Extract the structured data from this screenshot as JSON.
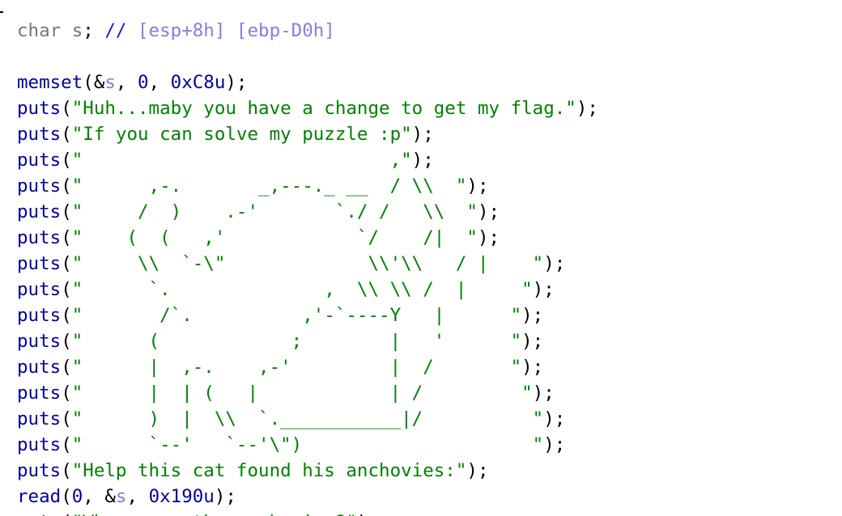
{
  "lines": [
    [
      {
        "t": "char",
        "c": "type"
      },
      {
        "t": " ",
        "c": "punct"
      },
      {
        "t": "s",
        "c": "var-gray"
      },
      {
        "t": "; ",
        "c": "punct"
      },
      {
        "t": "// ",
        "c": "comment"
      },
      {
        "t": "[esp+8h] [ebp-D0h]",
        "c": "addr"
      }
    ],
    [],
    [
      {
        "t": "memset",
        "c": "func"
      },
      {
        "t": "(&",
        "c": "punct"
      },
      {
        "t": "s",
        "c": "var"
      },
      {
        "t": ", ",
        "c": "punct"
      },
      {
        "t": "0",
        "c": "num"
      },
      {
        "t": ", ",
        "c": "punct"
      },
      {
        "t": "0xC8u",
        "c": "num"
      },
      {
        "t": ");",
        "c": "punct"
      }
    ],
    [
      {
        "t": "puts",
        "c": "func"
      },
      {
        "t": "(",
        "c": "punct"
      },
      {
        "t": "\"Huh...maby you have a change to get my flag.\"",
        "c": "str"
      },
      {
        "t": ");",
        "c": "punct"
      }
    ],
    [
      {
        "t": "puts",
        "c": "func"
      },
      {
        "t": "(",
        "c": "punct"
      },
      {
        "t": "\"If you can solve my puzzle :p\"",
        "c": "str"
      },
      {
        "t": ");",
        "c": "punct"
      }
    ],
    [
      {
        "t": "puts",
        "c": "func"
      },
      {
        "t": "(",
        "c": "punct"
      },
      {
        "t": "\"                            ,\"",
        "c": "str"
      },
      {
        "t": ");",
        "c": "punct"
      }
    ],
    [
      {
        "t": "puts",
        "c": "func"
      },
      {
        "t": "(",
        "c": "punct"
      },
      {
        "t": "\"      ,-.       _,---._ __  / \\\\  \"",
        "c": "str"
      },
      {
        "t": ");",
        "c": "punct"
      }
    ],
    [
      {
        "t": "puts",
        "c": "func"
      },
      {
        "t": "(",
        "c": "punct"
      },
      {
        "t": "\"     /  )    .-'       `./ /   \\\\  \"",
        "c": "str"
      },
      {
        "t": ");",
        "c": "punct"
      }
    ],
    [
      {
        "t": "puts",
        "c": "func"
      },
      {
        "t": "(",
        "c": "punct"
      },
      {
        "t": "\"    (  (   ,'            `/    /|  \"",
        "c": "str"
      },
      {
        "t": ");",
        "c": "punct"
      }
    ],
    [
      {
        "t": "puts",
        "c": "func"
      },
      {
        "t": "(",
        "c": "punct"
      },
      {
        "t": "\"     \\\\  `-\\\"             \\\\'\\\\   / |    \"",
        "c": "str"
      },
      {
        "t": ");",
        "c": "punct"
      }
    ],
    [
      {
        "t": "puts",
        "c": "func"
      },
      {
        "t": "(",
        "c": "punct"
      },
      {
        "t": "\"      `.              ,  \\\\ \\\\ /  |     \"",
        "c": "str"
      },
      {
        "t": ");",
        "c": "punct"
      }
    ],
    [
      {
        "t": "puts",
        "c": "func"
      },
      {
        "t": "(",
        "c": "punct"
      },
      {
        "t": "\"       /`.          ,'-`----Y   |      \"",
        "c": "str"
      },
      {
        "t": ");",
        "c": "punct"
      }
    ],
    [
      {
        "t": "puts",
        "c": "func"
      },
      {
        "t": "(",
        "c": "punct"
      },
      {
        "t": "\"      (            ;        |   '      \"",
        "c": "str"
      },
      {
        "t": ");",
        "c": "punct"
      }
    ],
    [
      {
        "t": "puts",
        "c": "func"
      },
      {
        "t": "(",
        "c": "punct"
      },
      {
        "t": "\"      |  ,-.    ,-'         |  /       \"",
        "c": "str"
      },
      {
        "t": ");",
        "c": "punct"
      }
    ],
    [
      {
        "t": "puts",
        "c": "func"
      },
      {
        "t": "(",
        "c": "punct"
      },
      {
        "t": "\"      |  | (   |            | /         \"",
        "c": "str"
      },
      {
        "t": ");",
        "c": "punct"
      }
    ],
    [
      {
        "t": "puts",
        "c": "func"
      },
      {
        "t": "(",
        "c": "punct"
      },
      {
        "t": "\"      )  |  \\\\  `.___________|/          \"",
        "c": "str"
      },
      {
        "t": ");",
        "c": "punct"
      }
    ],
    [
      {
        "t": "puts",
        "c": "func"
      },
      {
        "t": "(",
        "c": "punct"
      },
      {
        "t": "\"      `--'   `--'\\\")                     \"",
        "c": "str"
      },
      {
        "t": ");",
        "c": "punct"
      }
    ],
    [
      {
        "t": "puts",
        "c": "func"
      },
      {
        "t": "(",
        "c": "punct"
      },
      {
        "t": "\"Help this cat found his anchovies:\"",
        "c": "str"
      },
      {
        "t": ");",
        "c": "punct"
      }
    ],
    [
      {
        "t": "read",
        "c": "func"
      },
      {
        "t": "(",
        "c": "punct"
      },
      {
        "t": "0",
        "c": "num"
      },
      {
        "t": ", &",
        "c": "punct"
      },
      {
        "t": "s",
        "c": "var"
      },
      {
        "t": ", ",
        "c": "punct"
      },
      {
        "t": "0x190u",
        "c": "num"
      },
      {
        "t": ");",
        "c": "punct"
      }
    ],
    [
      {
        "t": "puts",
        "c": "func"
      },
      {
        "t": "(",
        "c": "punct"
      },
      {
        "t": "\"Where are the anchovies?\"",
        "c": "str"
      },
      {
        "t": ");",
        "c": "punct"
      }
    ]
  ]
}
